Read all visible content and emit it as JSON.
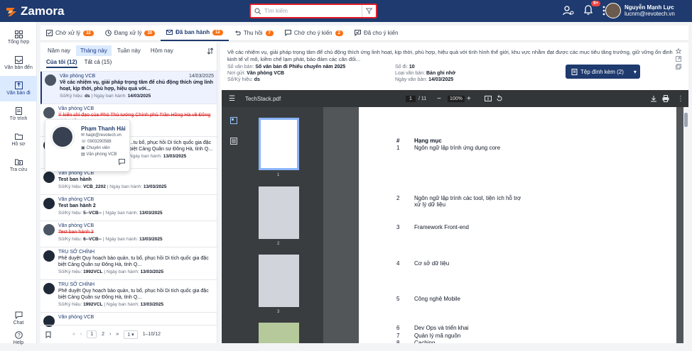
{
  "app": {
    "name": "Zamora"
  },
  "search": {
    "placeholder": "Tìm kiếm"
  },
  "notifications": {
    "badge": "9+"
  },
  "user": {
    "name": "Nguyễn Mạnh Lực",
    "email": "lucnm@revotech.vn"
  },
  "nav": [
    {
      "label": "Tổng hợp",
      "icon": "dashboard-icon"
    },
    {
      "label": "Văn bản đến",
      "icon": "inbox-icon"
    },
    {
      "label": "Văn bản đi",
      "icon": "outbox-icon"
    },
    {
      "label": "Tờ trình",
      "icon": "document-icon"
    },
    {
      "label": "Hồ sơ",
      "icon": "folder-icon"
    },
    {
      "label": "Tra cứu",
      "icon": "search-folder-icon"
    }
  ],
  "nav_bottom": [
    {
      "label": "Chat"
    },
    {
      "label": "Help"
    }
  ],
  "tabs": [
    {
      "label": "Chờ xử lý",
      "count": "32"
    },
    {
      "label": "Đang xử lý",
      "count": "30"
    },
    {
      "label": "Đã ban hành",
      "count": "12"
    },
    {
      "label": "Thu hồi",
      "count": "7"
    },
    {
      "label": "Chờ cho ý kiến",
      "count": "2"
    },
    {
      "label": "Đã cho ý kiến",
      "count": ""
    }
  ],
  "periods": [
    "Năm nay",
    "Tháng này",
    "Tuần này",
    "Hôm nay"
  ],
  "scope": [
    "Của tôi (12)",
    "Tất cả (15)"
  ],
  "list_items": [
    {
      "org": "Văn phòng VCB",
      "date": "14/03/2025",
      "title": "Về các nhiệm vụ, giải pháp trọng tâm để chủ động thích ứng linh hoạt, kịp thời, phù hợp, hiệu quả với...",
      "sokyhieu": "ds",
      "ngay": "14/03/2025"
    },
    {
      "org": "Văn phòng VCB",
      "date": "",
      "title": "Ý kiến chỉ đạo của Phó Thủ tướng Chính phủ Trần Hồng Hà về Đồng Tháp để...",
      "sokyhieu": "",
      "ngay": ""
    },
    {
      "org": "",
      "date": "",
      "title": "...tu bổ, phục hồi Di tích quốc gia đặc biệt Cảng Quân sự Đông Hà, tỉnh Q...",
      "sokyhieu": "",
      "ngay": "13/03/2025"
    },
    {
      "org": "Văn phòng VCB",
      "date": "",
      "title": "Test ban hành",
      "sokyhieu": "VCB_2202",
      "ngay": "13/03/2025"
    },
    {
      "org": "Văn phòng VCB",
      "date": "",
      "title": "Test ban hành 2",
      "sokyhieu": "5--VCB--",
      "ngay": "13/03/2025"
    },
    {
      "org": "Văn phòng VCB",
      "date": "",
      "title": "Test ban hành 3",
      "sokyhieu": "6--VCB--",
      "ngay": "13/03/2025"
    },
    {
      "org": "TRỤ SỞ CHÍNH",
      "date": "",
      "title": "Phê duyệt Quy hoạch bảo quản, tu bổ, phục hồi Di tích quốc gia đặc biệt Cảng Quân sự Đông Hà, tỉnh Q...",
      "sokyhieu": "1992VCL",
      "ngay": "13/03/2025"
    },
    {
      "org": "TRỤ SỞ CHÍNH",
      "date": "",
      "title": "Phê duyệt Quy hoạch bảo quản, tu bổ, phục hồi Di tích quốc gia đặc biệt Cảng Quân sự Đông Hà, tỉnh Q...",
      "sokyhieu": "1992VCL",
      "ngay": "13/03/2025"
    },
    {
      "org": "Văn phòng VCB",
      "date": "",
      "title": "",
      "sokyhieu": "",
      "ngay": ""
    }
  ],
  "labels": {
    "sokyhieu": "Số/Ký hiệu:",
    "ngay": "Ngày ban hành:"
  },
  "popup": {
    "name": "Phạm Thanh Hải",
    "email": "haipt@revotech.vn",
    "phone": "0903290588",
    "role": "Chuyên viên",
    "org": "Văn phòng VCB"
  },
  "pager": {
    "pages": [
      "1",
      "2"
    ],
    "size": "1",
    "range": "1–10/12"
  },
  "detail": {
    "summary": "Về các nhiệm vụ, giải pháp trọng tâm để chủ động thích ứng linh hoạt, kịp thời, phù hợp, hiệu quả với tình hình thế giới, khu vực nhằm đạt được các mục tiêu tăng trưởng, giữ vững ổn định kinh tế vĩ mô, kiềm chế lạm phát, bảo đảm các cân đối...",
    "so_van_ban_label": "Số văn bản:",
    "so_van_ban": "Số văn bản đi Phiếu chuyển năm 2025",
    "noi_gui_label": "Nơi gửi:",
    "noi_gui": "Văn phòng VCB",
    "so_ky_hieu_label": "Số/Ký hiệu:",
    "so_ky_hieu": "ds",
    "so_di_label": "Số đi:",
    "so_di": "10",
    "loai_label": "Loại văn bản:",
    "loai": "Bản ghi nhớ",
    "ngay_label": "Ngày văn bản:",
    "ngay": "14/03/2025",
    "attach": "Tệp đính kèm (2)"
  },
  "pdf": {
    "filename": "TechStack.pdf",
    "page": "1",
    "total": "/ 11",
    "zoom": "100%",
    "thumbs": [
      "1",
      "2",
      "3"
    ],
    "header_num": "#",
    "header_title": "Hạng mục",
    "rows": [
      {
        "num": "1",
        "text": "Ngôn ngữ lập trình ứng dụng core"
      },
      {
        "num": "2",
        "text": "Ngôn ngữ lập trình các tool, tiện ích hỗ trợ xử lý dữ liệu"
      },
      {
        "num": "3",
        "text": "Framework Front-end"
      },
      {
        "num": "4",
        "text": "Cơ sở dữ liệu"
      },
      {
        "num": "5",
        "text": "Công nghệ Mobile"
      },
      {
        "num": "6",
        "text": "Dev Ops và triển khai"
      },
      {
        "num": "7",
        "text": "Quản lý mã nguồn"
      },
      {
        "num": "8",
        "text": "Caching"
      }
    ]
  }
}
